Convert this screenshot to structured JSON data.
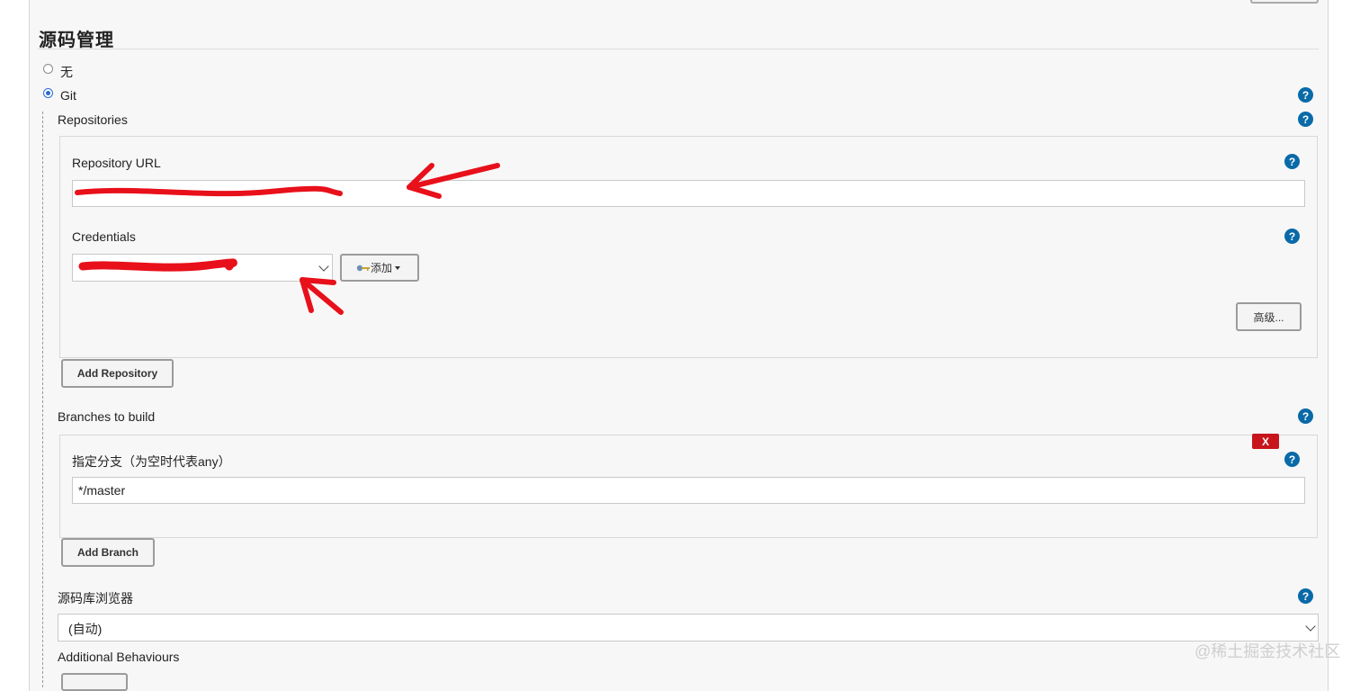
{
  "section": {
    "title": "源码管理"
  },
  "scm_options": {
    "none_label": "无",
    "git_label": "Git",
    "selected": "Git"
  },
  "repositories": {
    "label": "Repositories",
    "repository_url": {
      "label": "Repository URL",
      "value": ""
    },
    "credentials": {
      "label": "Credentials",
      "value": "",
      "add_label": "添加"
    },
    "advanced_label": "高级...",
    "add_repository_label": "Add Repository"
  },
  "branches": {
    "label": "Branches to build",
    "delete_label": "X",
    "branch_specifier": {
      "label": "指定分支（为空时代表any）",
      "value": "*/master"
    },
    "add_branch_label": "Add Branch"
  },
  "repo_browser": {
    "label": "源码库浏览器",
    "selected": "(自动)"
  },
  "additional_behaviours": {
    "label": "Additional Behaviours"
  },
  "help_icon_text": "?",
  "watermark": "@稀土掘金技术社区",
  "colors": {
    "help_icon": "#0a6aa8",
    "annotation_red": "#e8101a",
    "delete_button": "#c8141b"
  }
}
